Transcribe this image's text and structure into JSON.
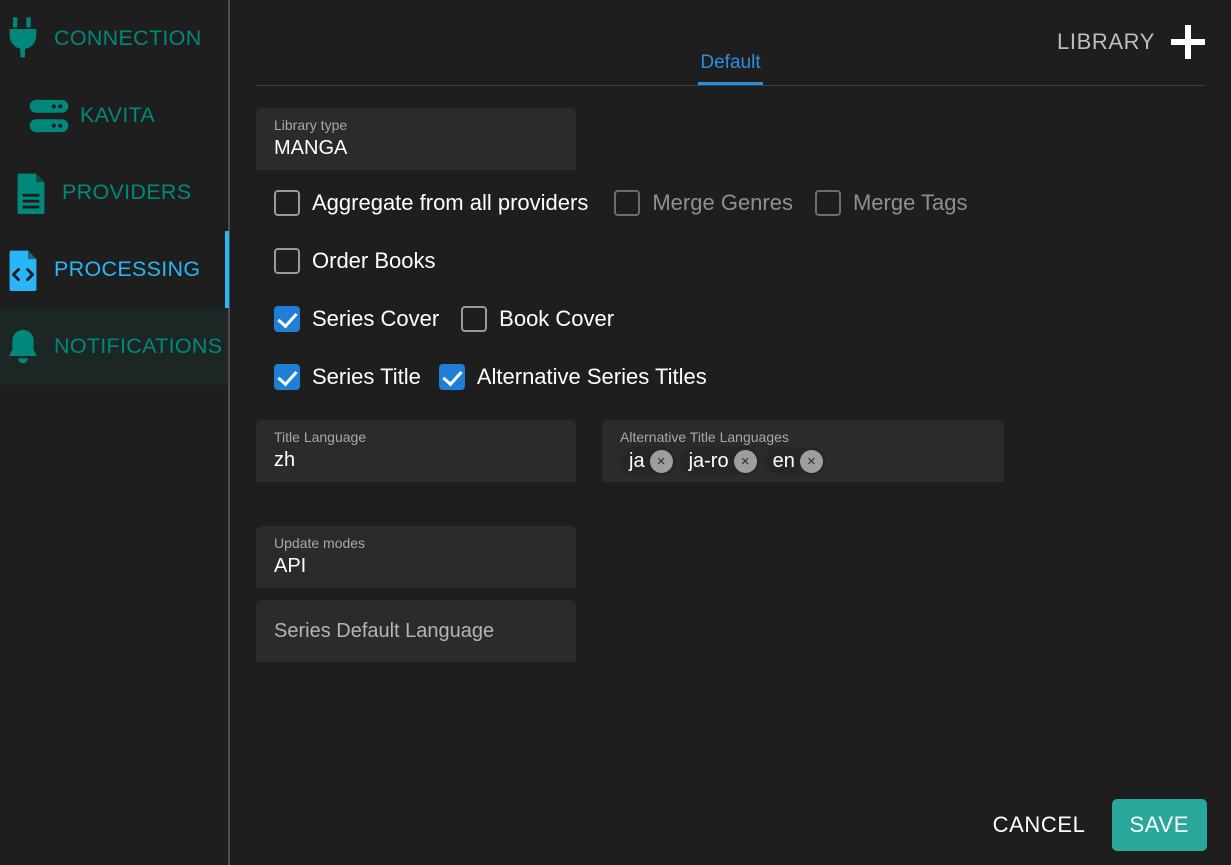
{
  "sidebar": {
    "items": [
      {
        "label": "CONNECTION",
        "icon": "plug-icon",
        "state": "normal"
      },
      {
        "label": "KAVITA",
        "icon": "server-icon",
        "state": "normal"
      },
      {
        "label": "PROVIDERS",
        "icon": "document-icon",
        "state": "normal"
      },
      {
        "label": "PROCESSING",
        "icon": "code-file-icon",
        "state": "active"
      },
      {
        "label": "NOTIFICATIONS",
        "icon": "bell-icon",
        "state": "hover"
      }
    ]
  },
  "header": {
    "tabs": [
      {
        "label": "Default",
        "selected": true
      }
    ],
    "library_label": "LIBRARY",
    "add_icon": "plus-icon"
  },
  "form": {
    "library_type": {
      "label": "Library type",
      "value": "MANGA"
    },
    "checkbox_rows": [
      [
        {
          "label": "Aggregate from all providers",
          "checked": false,
          "disabled": false
        },
        {
          "label": "Merge Genres",
          "checked": false,
          "disabled": true
        },
        {
          "label": "Merge Tags",
          "checked": false,
          "disabled": true
        }
      ],
      [
        {
          "label": "Order Books",
          "checked": false,
          "disabled": false
        }
      ],
      [
        {
          "label": "Series Cover",
          "checked": true,
          "disabled": false
        },
        {
          "label": "Book Cover",
          "checked": false,
          "disabled": false
        }
      ],
      [
        {
          "label": "Series Title",
          "checked": true,
          "disabled": false
        },
        {
          "label": "Alternative Series Titles",
          "checked": true,
          "disabled": false
        }
      ]
    ],
    "title_language": {
      "label": "Title Language",
      "value": "zh"
    },
    "alternative_title_languages": {
      "label": "Alternative Title Languages",
      "chips": [
        "ja",
        "ja-ro",
        "en"
      ],
      "remove_icon": "close-icon",
      "remove_glyph": "×"
    },
    "update_modes": {
      "label": "Update modes",
      "value": "API"
    },
    "series_default_language": {
      "placeholder": "Series Default Language"
    }
  },
  "footer": {
    "cancel_label": "CANCEL",
    "save_label": "SAVE"
  },
  "colors": {
    "background": "#1e1e1e",
    "field": "#2b2b2b",
    "teal": "#00897b",
    "active_blue": "#29b6f6",
    "tab_blue": "#2b8fdd",
    "checkbox_blue": "#1f7fd6",
    "save_green": "#2aa79b"
  }
}
